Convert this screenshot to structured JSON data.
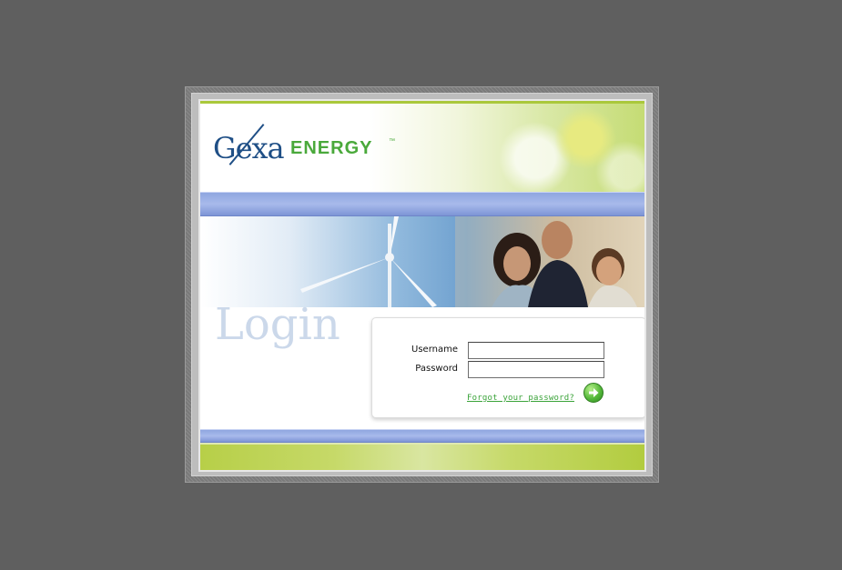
{
  "logo": {
    "brand_left": "Gexa",
    "brand_right": "Energy",
    "trademark": "™"
  },
  "login": {
    "title": "Login",
    "username_label": "Username",
    "username_value": "",
    "password_label": "Password",
    "password_value": "",
    "forgot_link": "Forgot your password?",
    "submit_icon": "arrow-right-icon"
  },
  "colors": {
    "background": "#5f5f5f",
    "brand_blue": "#1f4f86",
    "brand_green": "#4aa93b",
    "band_blue": "#8fa6e0",
    "footer_green": "#b7cf48",
    "link_green": "#3aa339"
  }
}
